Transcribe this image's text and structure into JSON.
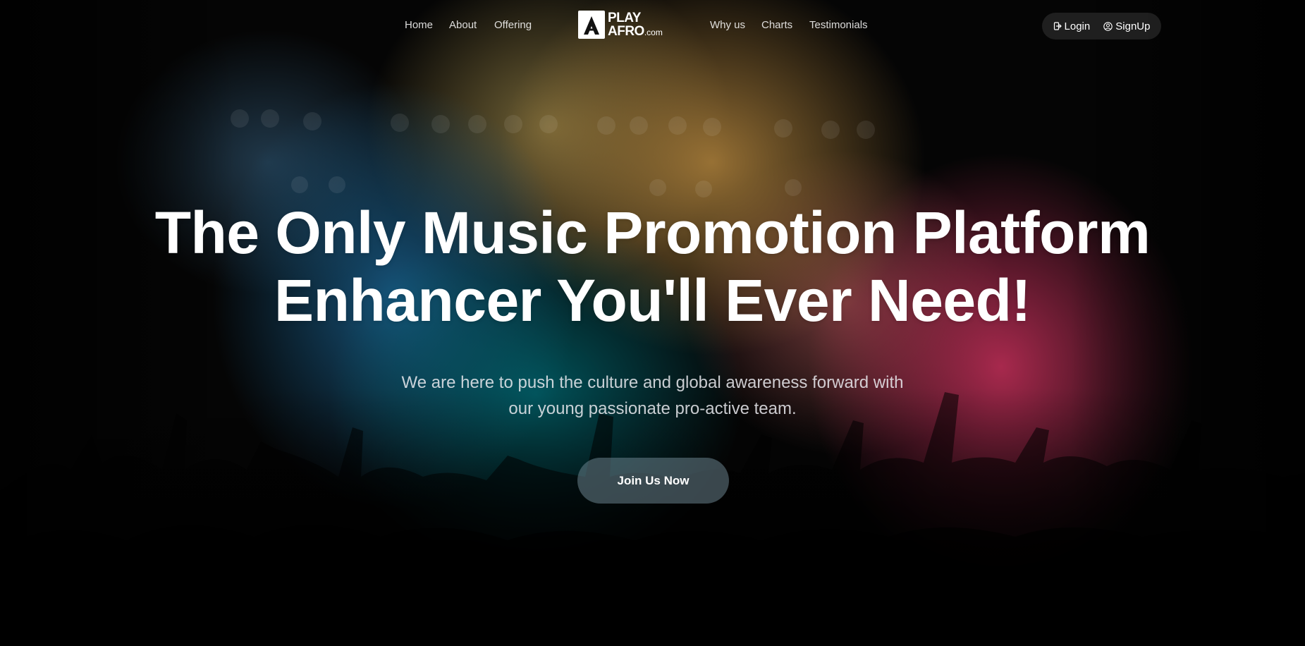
{
  "nav": {
    "left_links": [
      "Home",
      "About",
      "Offering"
    ],
    "right_links": [
      "Why us",
      "Charts",
      "Testimonials"
    ],
    "logo": {
      "play": "PLAY",
      "afro": "AFRO",
      "com": ".com"
    },
    "auth": {
      "login_label": "Login",
      "login_icon": "login-icon",
      "signup_label": "SignUp",
      "signup_icon": "user-circle-icon"
    }
  },
  "hero": {
    "headline_line1": "The Only Music Promotion Platform",
    "headline_line2": "Enhancer You'll Ever Need!",
    "subtitle_line1": "We are here to push the culture and global awareness forward with",
    "subtitle_line2": "our young passionate pro-active team.",
    "cta_label": "Join Us Now"
  },
  "colors": {
    "text": "#ffffff",
    "cta_bg": "#69828c",
    "auth_bg": "#282828",
    "bg_blue": "#195f8c",
    "bg_gold": "#af823c",
    "bg_pink": "#b92d55"
  }
}
